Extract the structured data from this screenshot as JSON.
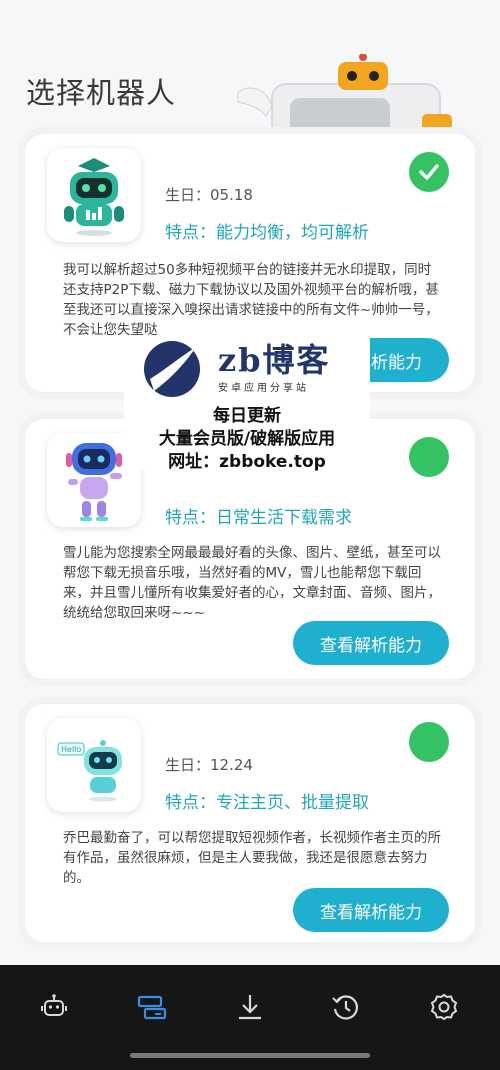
{
  "page": {
    "title": "选择机器人"
  },
  "colors": {
    "accent": "#1fb0d0",
    "feature_text": "#1fa7b7",
    "selected": "#34c263",
    "nav_active": "#3a8fe0",
    "nav_inactive": "#d8d8d8"
  },
  "robots": [
    {
      "avatar_icon": "green-robot-icon",
      "birthday": "生日：05.18",
      "feature": "特点：能力均衡，均可解析",
      "description": "我可以解析超过50多种短视频平台的链接并无水印提取，同时还支持P2P下载、磁力下载协议以及国外视频平台的解析哦，甚至我还可以直接深入嗅探出请求链接中的所有文件~帅帅一号，不会让您失望哒",
      "button_label": "查看解析能力",
      "selected": true
    },
    {
      "avatar_icon": "blue-robot-icon",
      "birthday": "",
      "feature": "特点：日常生活下载需求",
      "description": "雪儿能为您搜索全网最最最好看的头像、图片、壁纸，甚至可以帮您下载无损音乐哦，当然好看的MV，雪儿也能帮您下载回来，并且雪儿懂所有收集爱好者的心，文章封面、音频、图片，统统给您取回来呀~~~",
      "button_label": "查看解析能力",
      "selected": false
    },
    {
      "avatar_icon": "hello-robot-icon",
      "birthday": "生日：12.24",
      "feature": "特点：专注主页、批量提取",
      "description": "乔巴最勤奋了，可以帮您提取短视频作者，长视频作者主页的所有作品，虽然很麻烦，但是主人要我做，我还是很愿意去努力的。",
      "button_label": "查看解析能力",
      "selected": false
    }
  ],
  "watermark": {
    "brand": "zb博客",
    "subtitle": "安卓应用分享站",
    "line1": "每日更新",
    "line2": "大量会员版/破解版应用",
    "line3": "网址：zbboke.top"
  },
  "nav": [
    {
      "icon": "robot-icon",
      "active": false
    },
    {
      "icon": "tasks-icon",
      "active": true
    },
    {
      "icon": "download-icon",
      "active": false
    },
    {
      "icon": "history-icon",
      "active": false
    },
    {
      "icon": "settings-icon",
      "active": false
    }
  ]
}
